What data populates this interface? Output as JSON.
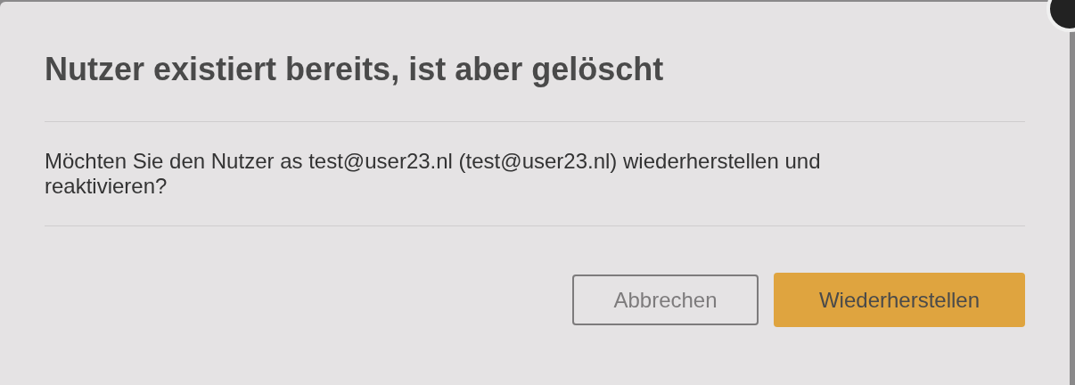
{
  "dialog": {
    "title": "Nutzer existiert bereits, ist aber gelöscht",
    "message": "Möchten Sie den Nutzer as test@user23.nl (test@user23.nl) wiederherstellen und reaktivieren?",
    "buttons": [
      {
        "label": "Abbrechen",
        "kind": "secondary"
      },
      {
        "label": "Wiederherstellen",
        "kind": "primary"
      }
    ]
  }
}
